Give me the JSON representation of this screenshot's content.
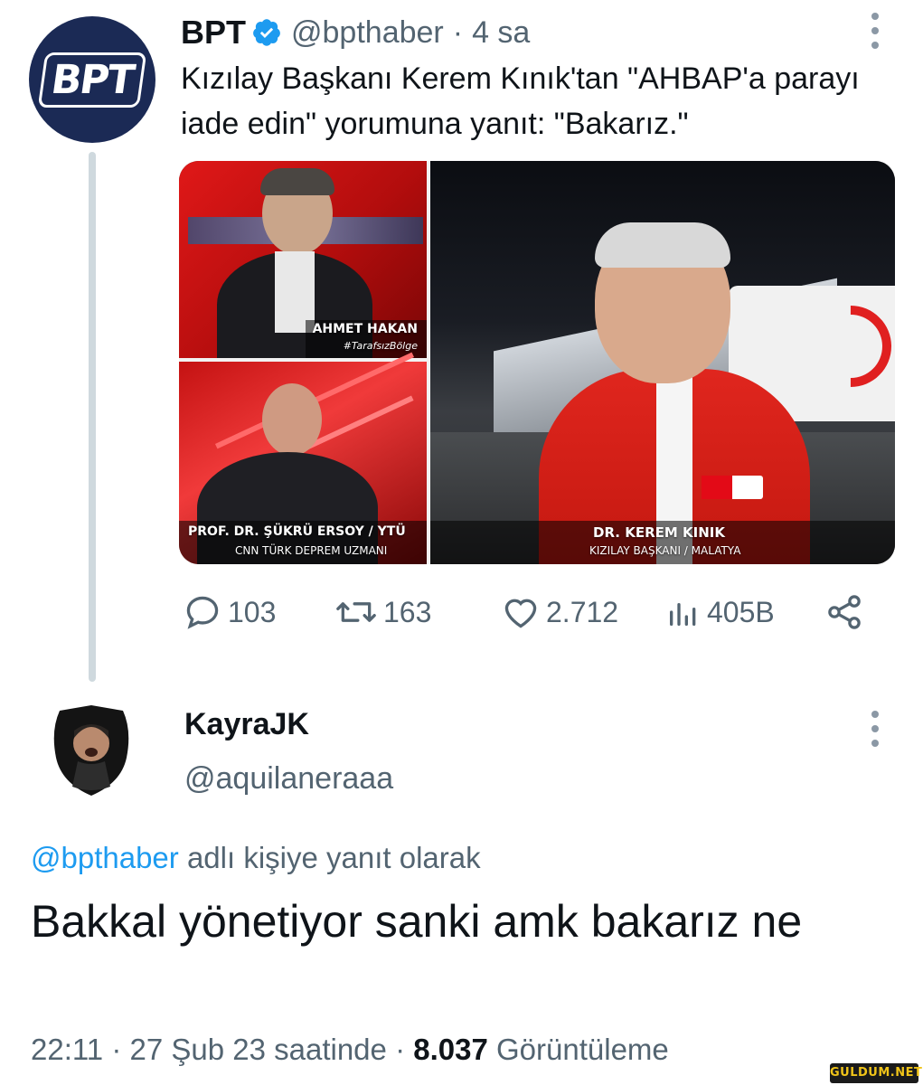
{
  "parent_tweet": {
    "display_name": "BPT",
    "handle": "@bpthaber",
    "age": "4 sa",
    "avatar_text": "BPT",
    "text": "Kızılay Başkanı Kerem Kınık'tan \"AHBAP'a parayı iade edin\" yorumuna yanıt: \"Bakarız.\"",
    "media": {
      "caption_1_name": "AHMET HAKAN",
      "caption_1_sub": "#TarafsızBölge",
      "caption_2_name": "PROF. DR. ŞÜKRÜ ERSOY / YTÜ",
      "caption_2_sub": "CNN TÜRK DEPREM UZMANI",
      "caption_3_name": "DR. KEREM KINIK",
      "caption_3_sub": "KIZILAY BAŞKANI / MALATYA"
    },
    "stats": {
      "replies": "103",
      "retweets": "163",
      "likes": "2.712",
      "views": "405B"
    }
  },
  "reply": {
    "display_name": "KayraJK",
    "handle": "@aquilaneraaa",
    "reply_to_mention": "@bpthaber",
    "reply_to_suffix": "adlı kişiye yanıt olarak",
    "text": "Bakkal yönetiyor sanki amk bakarız ne",
    "time": "22:11",
    "date": "27 Şub 23 saatinde",
    "views_count": "8.037",
    "views_label": "Görüntüleme"
  },
  "watermark": "GULDUM.NET",
  "colors": {
    "link": "#1d9bf0",
    "muted": "#536471",
    "text": "#0f1419",
    "avatar_bg": "#1b2a55"
  }
}
